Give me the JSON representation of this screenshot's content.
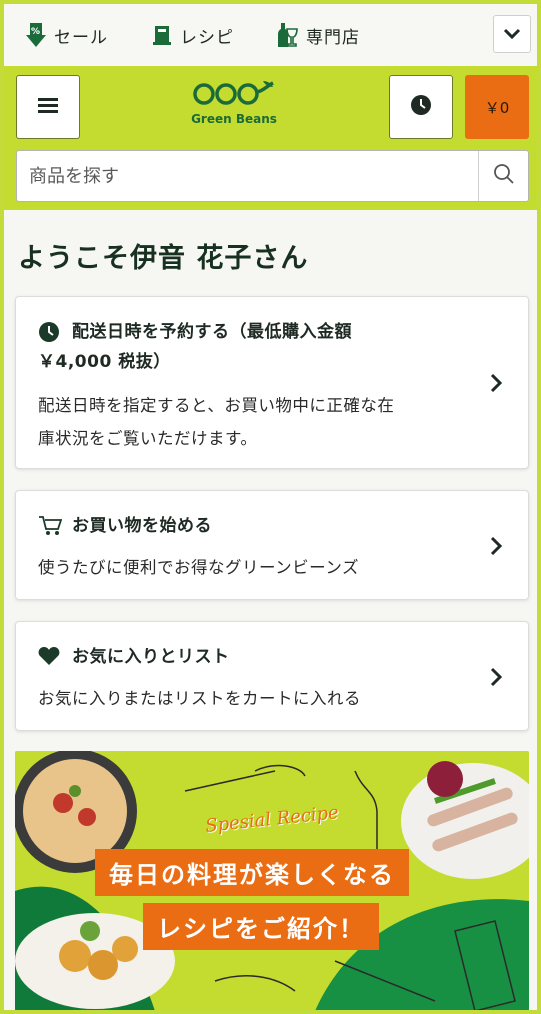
{
  "topnav": {
    "sale_label": "セール",
    "recipe_label": "レシピ",
    "shop_label": "専門店"
  },
  "header": {
    "logo_text": "Green Beans",
    "cart_label": "￥0"
  },
  "search": {
    "placeholder": "商品を探す"
  },
  "welcome": "ようこそ伊音 花子さん",
  "cards": [
    {
      "title_line1": "配送日時を予約する（最低購入金額",
      "title_line2": "￥4,000 税抜）",
      "desc_line1": "配送日時を指定すると、お買い物中に正確な在",
      "desc_line2": "庫状況をご覧いただけます。"
    },
    {
      "title": "お買い物を始める",
      "desc": "使うたびに便利でお得なグリーンビーンズ"
    },
    {
      "title": "お気に入りとリスト",
      "desc": "お気に入りまたはリストをカートに入れる"
    }
  ],
  "banner": {
    "subtitle": "Spesial Recipe",
    "line1": "毎日の料理が楽しくなる",
    "line2": "レシピをご紹介！"
  },
  "colors": {
    "brand_green": "#c3dc2f",
    "dark_green": "#1b6b3a",
    "orange": "#ea6c13"
  }
}
